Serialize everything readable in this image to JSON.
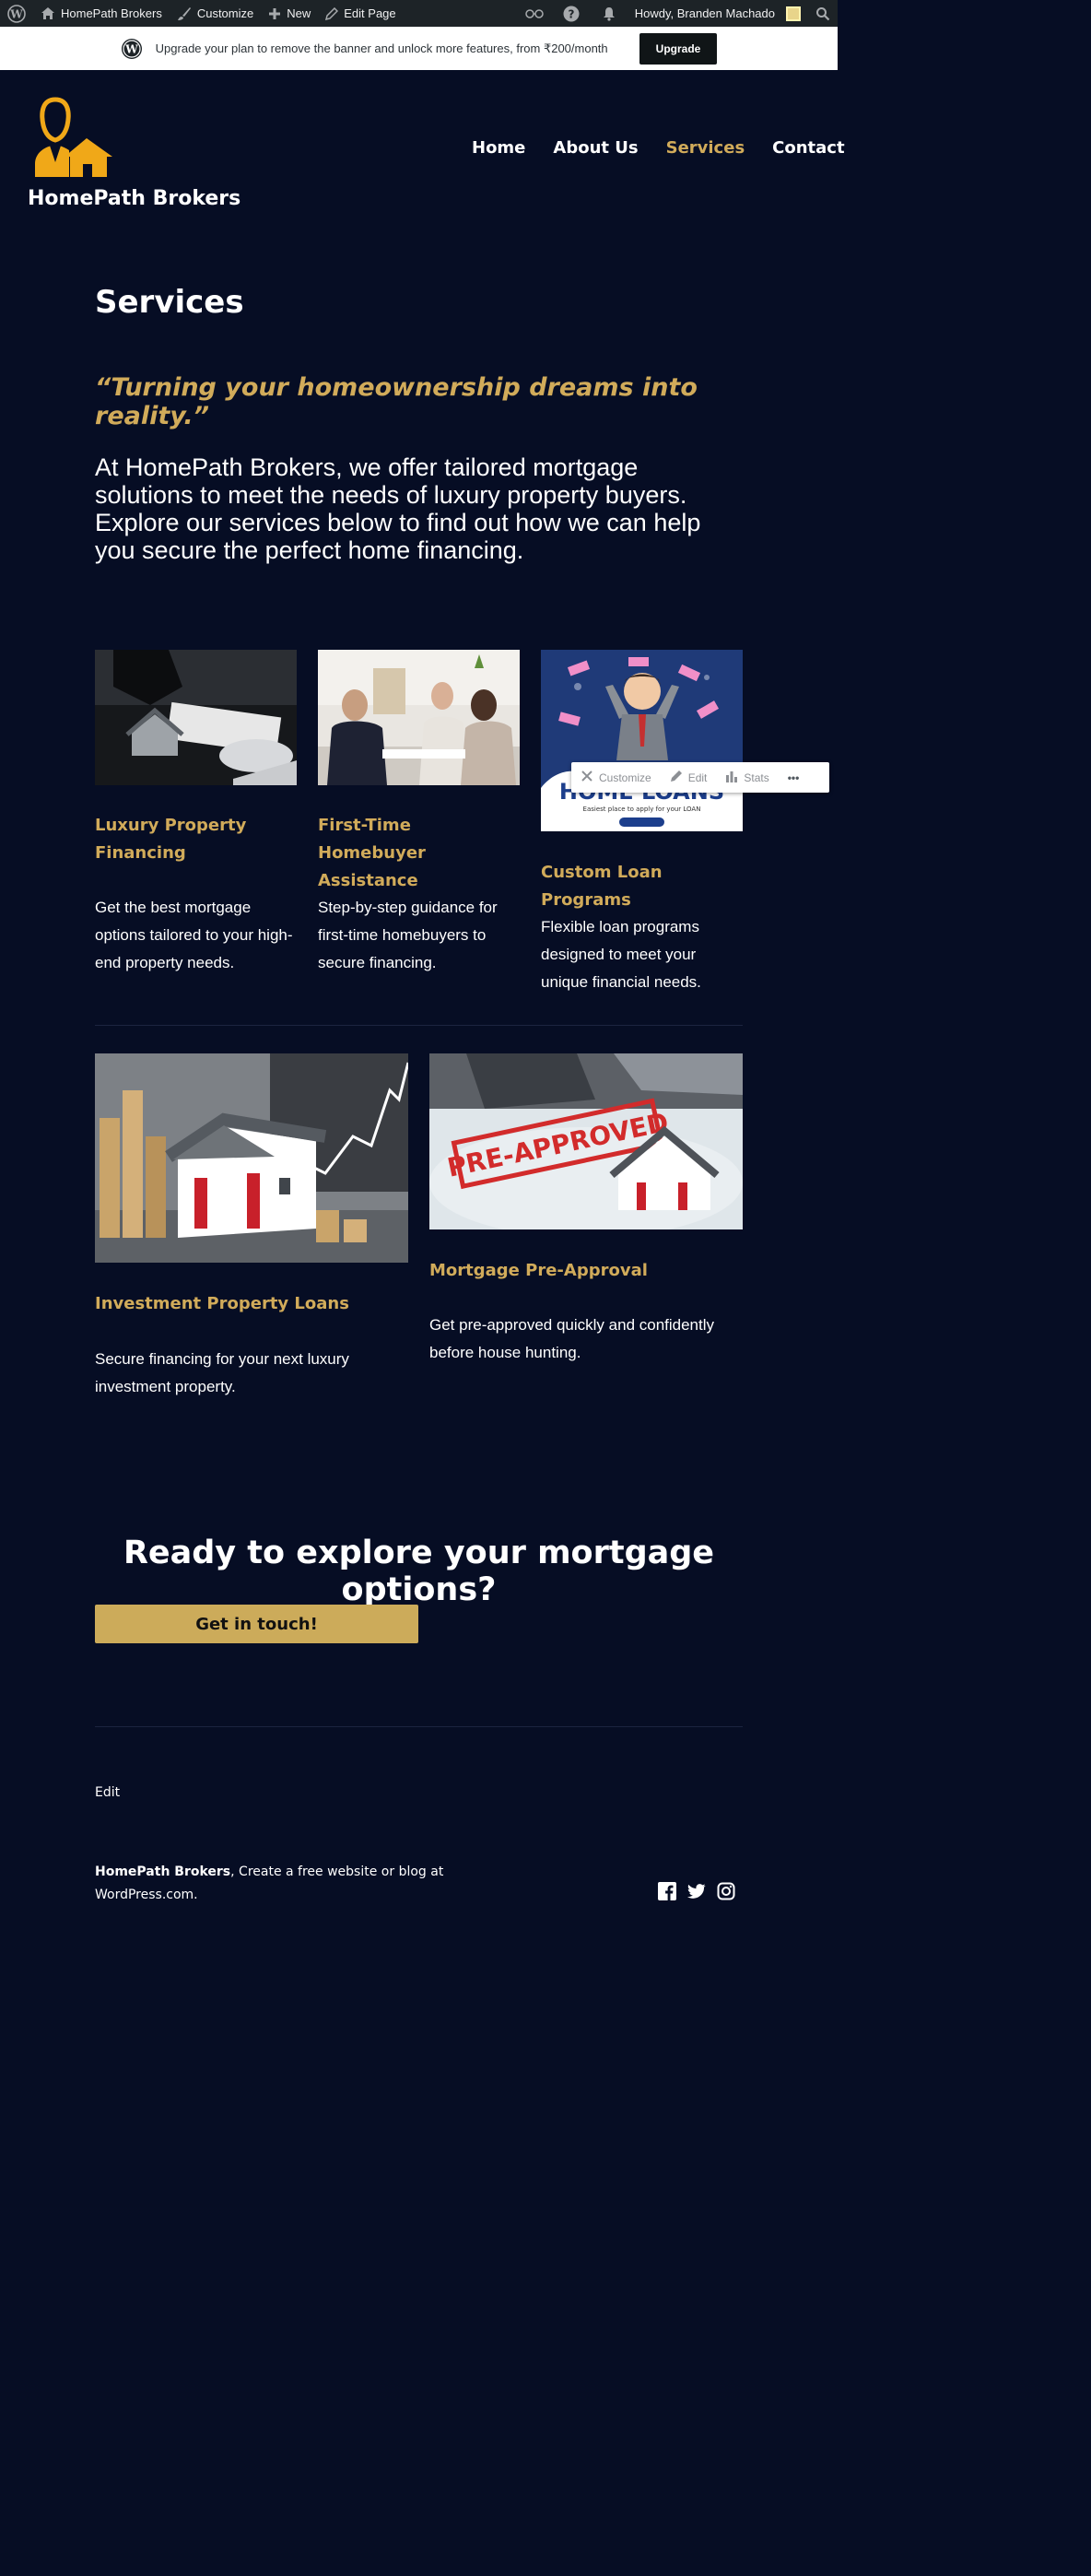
{
  "admin_bar": {
    "site_name": "HomePath Brokers",
    "customize": "Customize",
    "new": "New",
    "edit_page": "Edit Page",
    "howdy": "Howdy, Branden Machado"
  },
  "banner": {
    "text": "Upgrade your plan to remove the banner and unlock more features, from ₹200/month",
    "button": "Upgrade"
  },
  "header": {
    "site_title": "HomePath Brokers",
    "nav": [
      "Home",
      "About Us",
      "Services",
      "Contact"
    ],
    "active_nav": "Services"
  },
  "page": {
    "title": "Services",
    "tagline": "“Turning your homeownership dreams into reality.”",
    "intro": "At HomePath Brokers, we offer tailored mortgage solutions to meet the needs of luxury property buyers. Explore our services below to find out how we can help you secure the perfect home financing."
  },
  "services": [
    {
      "title": "Luxury Property Financing",
      "text": "Get the best mortgage options tailored to your high-end property needs."
    },
    {
      "title": "First-Time Homebuyer Assistance",
      "text": "Step-by-step guidance for first-time homebuyers to secure financing."
    },
    {
      "title": "Custom Loan Programs",
      "text": "Flexible loan programs designed to meet your unique financial needs."
    },
    {
      "title": "Investment Property Loans",
      "text": "Secure financing for your next luxury investment property."
    },
    {
      "title": "Mortgage Pre-Approval",
      "text": "Get pre-approved quickly and confidently before house hunting."
    }
  ],
  "image_text": {
    "home_loans": "HOME LOANS",
    "home_loans_sub": "Easiest place to apply for your LOAN",
    "pre_approved": "PRE-APPROVED"
  },
  "toolbar": {
    "customize": "Customize",
    "edit": "Edit",
    "stats": "Stats",
    "more": "•••"
  },
  "cta": {
    "title": "Ready to explore your mortgage options?",
    "button": "Get in touch!"
  },
  "footer": {
    "edit": "Edit",
    "credit_name": "HomePath Brokers",
    "credit_rest": ", Create a free website or blog at WordPress.com."
  },
  "colors": {
    "background": "#060d24",
    "accent": "#d1ab5a",
    "button": "#ccab5a",
    "admin_bar": "#1d2327"
  },
  "icons": [
    "wordpress-icon",
    "home-icon",
    "brush-icon",
    "plus-icon",
    "pencil-icon",
    "reader-icon",
    "help-icon",
    "bell-icon",
    "search-icon",
    "facebook-icon",
    "twitter-icon",
    "instagram-icon",
    "tools-icon",
    "stats-icon"
  ]
}
